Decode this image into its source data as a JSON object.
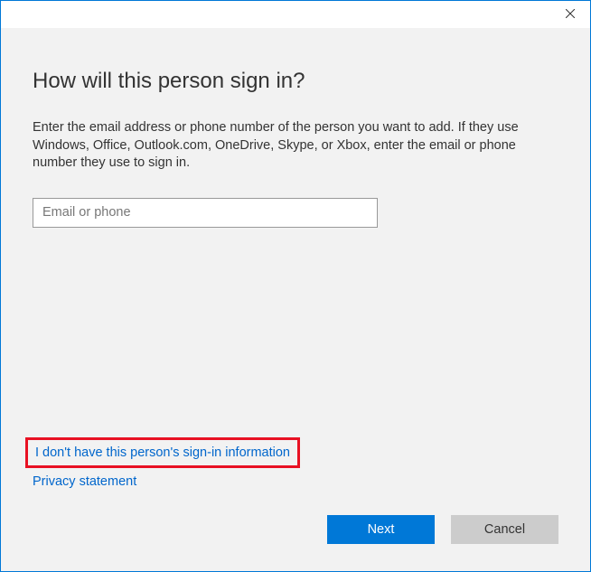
{
  "dialog": {
    "heading": "How will this person sign in?",
    "description": "Enter the email address or phone number of the person you want to add. If they use Windows, Office, Outlook.com, OneDrive, Skype, or Xbox, enter the email or phone number they use to sign in.",
    "input": {
      "placeholder": "Email or phone",
      "value": ""
    },
    "links": {
      "no_info": "I don't have this person's sign-in information",
      "privacy": "Privacy statement"
    },
    "buttons": {
      "next": "Next",
      "cancel": "Cancel"
    }
  }
}
